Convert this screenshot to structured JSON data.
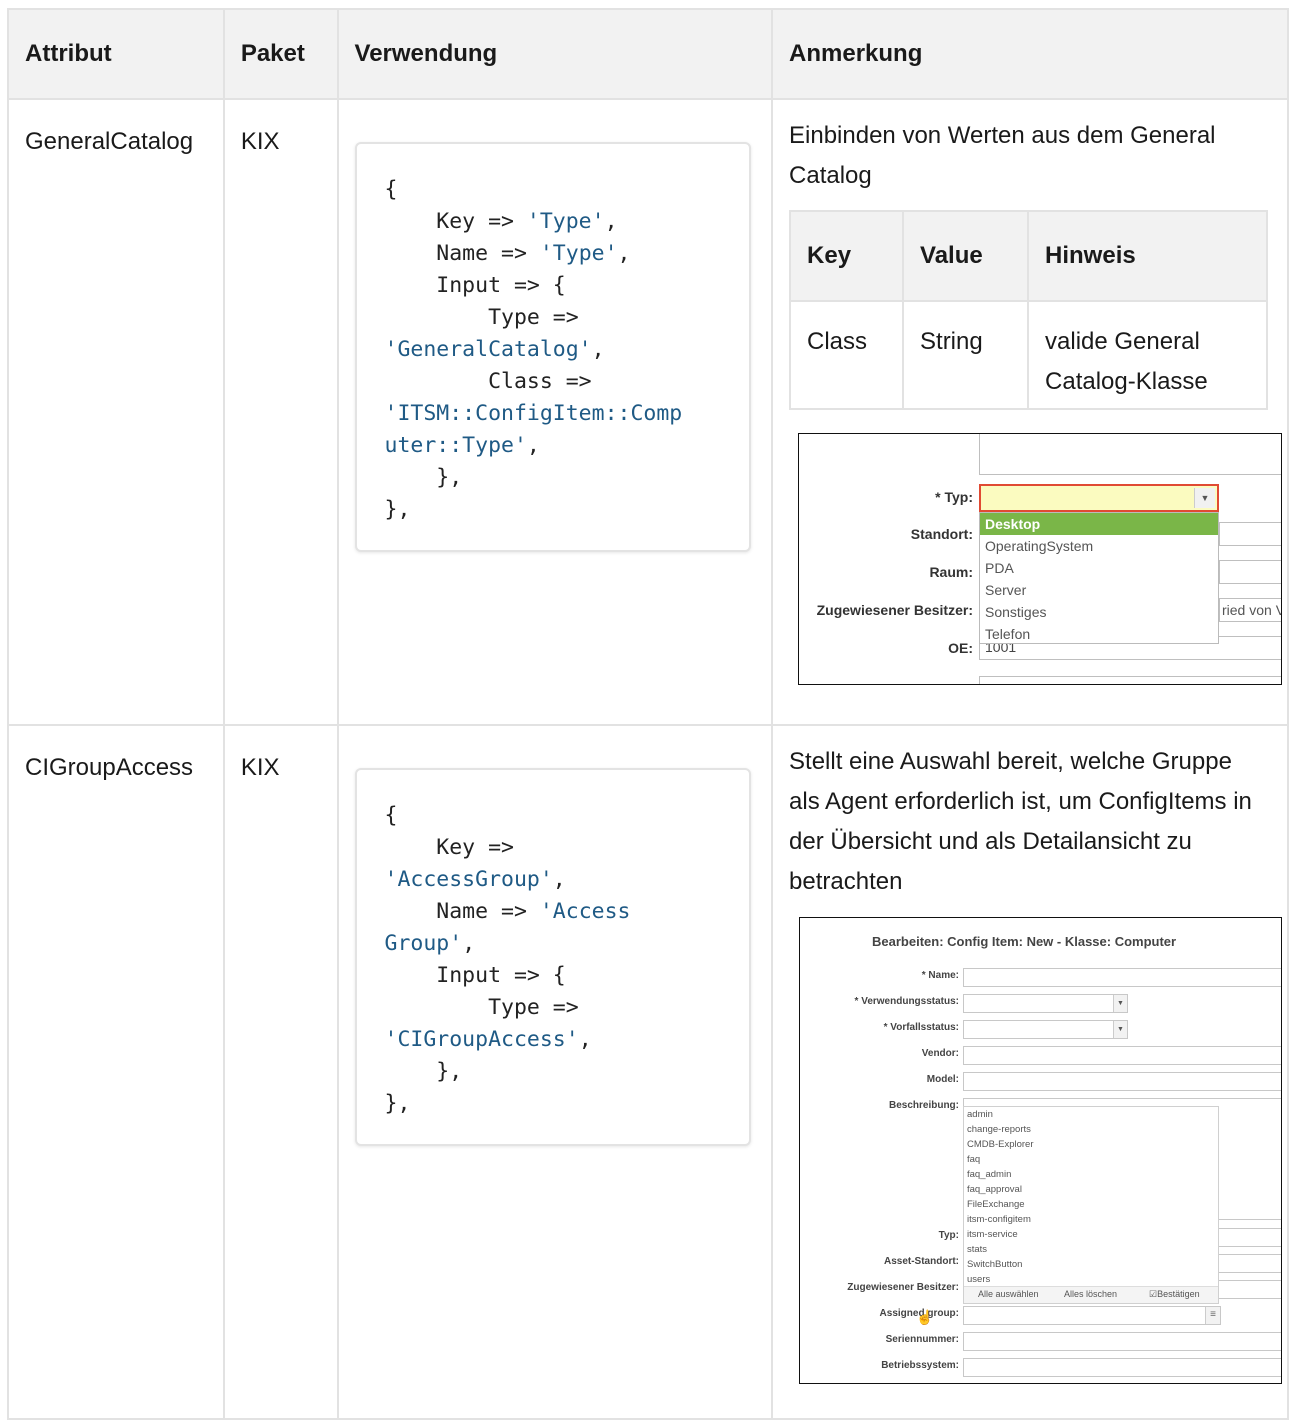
{
  "headers": {
    "attribut": "Attribut",
    "paket": "Paket",
    "verwendung": "Verwendung",
    "anmerkung": "Anmerkung"
  },
  "rows": [
    {
      "attribut": "GeneralCatalog",
      "paket": "KIX",
      "code_lines": [
        [
          "{"
        ],
        [
          "    Key => ",
          "'Type'",
          ","
        ],
        [
          "    Name => ",
          "'Type'",
          ","
        ],
        [
          "    Input => {"
        ],
        [
          "        Type => "
        ],
        [
          "",
          "'GeneralCatalog'",
          ","
        ],
        [
          "        Class => "
        ],
        [
          "",
          "'ITSM::ConfigItem::Comp"
        ],
        [
          "",
          "uter::Type'",
          ","
        ],
        [
          "    },"
        ],
        [
          "},"
        ]
      ],
      "note": "Einbinden von Werten aus dem General Catalog",
      "sub_table": {
        "headers": [
          "Key",
          "Value",
          "Hinweis"
        ],
        "rows": [
          [
            "Class",
            "String",
            "valide General Catalog-Klasse"
          ]
        ]
      },
      "screenshot": {
        "labels": {
          "typ": "* Typ:",
          "standort": "Standort:",
          "raum": "Raum:",
          "besitzer": "Zugewiesener Besitzer:",
          "oe": "OE:"
        },
        "options": [
          "Desktop",
          "OperatingSystem",
          "PDA",
          "Server",
          "Sonstiges",
          "Telefon"
        ],
        "selected_option": "Desktop",
        "oe_value": "1001",
        "besitzer_partial": "ried von V"
      }
    },
    {
      "attribut": "CIGroupAccess",
      "paket": "KIX",
      "code_lines": [
        [
          "{"
        ],
        [
          "    Key => "
        ],
        [
          "",
          "'AccessGroup'",
          ","
        ],
        [
          "    Name => ",
          "'Access"
        ],
        [
          "",
          "Group'",
          ","
        ],
        [
          "    Input => {"
        ],
        [
          "        Type => "
        ],
        [
          "",
          "'CIGroupAccess'",
          ","
        ],
        [
          "    },"
        ],
        [
          "},"
        ]
      ],
      "note": "Stellt eine Auswahl bereit, welche Gruppe als Agent erforderlich ist, um ConfigItems in der Übersicht und als Detailansicht zu betrachten",
      "screenshot": {
        "title": "Bearbeiten: Config Item: New - Klasse: Computer",
        "labels": {
          "name": "* Name:",
          "verwendungsstatus": "* Verwendungsstatus:",
          "vorfallsstatus": "* Vorfallsstatus:",
          "vendor": "Vendor:",
          "model": "Model:",
          "beschreibung": "Beschreibung:",
          "typ": "Typ:",
          "asset_standort": "Asset-Standort:",
          "besitzer": "Zugewiesener Besitzer:",
          "assigned_group": "Assigned group:",
          "seriennummer": "Seriennummer:",
          "betriebssystem": "Betriebssystem:"
        },
        "groups": [
          "admin",
          "change-reports",
          "CMDB-Explorer",
          "faq",
          "faq_admin",
          "faq_approval",
          "FileExchange",
          "itsm-configitem",
          "itsm-service",
          "stats",
          "SwitchButton",
          "users"
        ],
        "actions": {
          "select_all": "Alle auswählen",
          "clear_all": "Alles löschen",
          "confirm": "☑Bestätigen"
        }
      }
    }
  ]
}
